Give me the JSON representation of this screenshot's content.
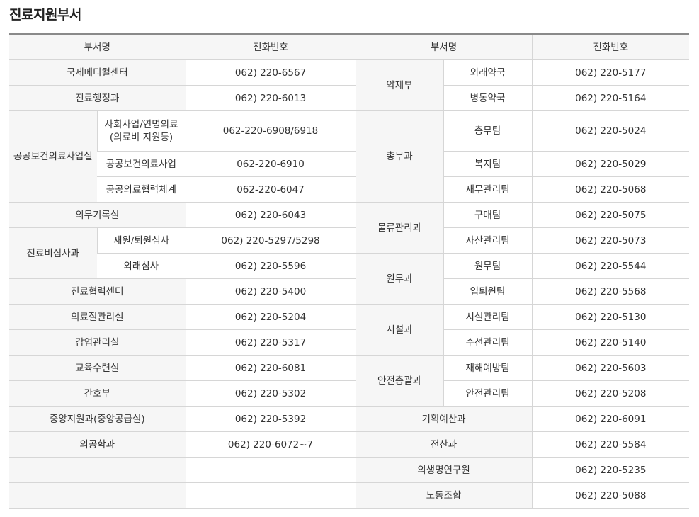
{
  "title": "진료지원부서",
  "headers": {
    "dept": "부서명",
    "phone": "전화번호"
  },
  "left": {
    "r1": {
      "name": "국제메디컬센터",
      "phone": "062) 220-6567"
    },
    "r2": {
      "name": "진료행정과",
      "phone": "062) 220-6013"
    },
    "public": {
      "name": "공공보건의료사업실",
      "subs": [
        {
          "name_line1": "사회사업/연명의료",
          "name_line2": "(의료비 지원등)",
          "phone": "062-220-6908/6918"
        },
        {
          "name": "공공보건의료사업",
          "phone": "062-220-6910"
        },
        {
          "name": "공공의료협력체계",
          "phone": "062-220-6047"
        }
      ]
    },
    "r6": {
      "name": "의무기록실",
      "phone": "062) 220-6043"
    },
    "review": {
      "name": "진료비심사과",
      "subs": [
        {
          "name": "재원/퇴원심사",
          "phone": "062) 220-5297/5298"
        },
        {
          "name": "외래심사",
          "phone": "062) 220-5596"
        }
      ]
    },
    "r9": {
      "name": "진료협력센터",
      "phone": "062) 220-5400"
    },
    "r10": {
      "name": "의료질관리실",
      "phone": "062) 220-5204"
    },
    "r11": {
      "name": "감염관리실",
      "phone": "062) 220-5317"
    },
    "r12": {
      "name": "교육수련실",
      "phone": "062) 220-6081"
    },
    "r13": {
      "name": "간호부",
      "phone": "062) 220-5302"
    },
    "r14": {
      "name": "중앙지원과(중앙공급실)",
      "phone": "062) 220-5392"
    },
    "r15": {
      "name": "의공학과",
      "phone": "062) 220-6072~7"
    }
  },
  "right": {
    "pharmacy": {
      "name": "약제부",
      "subs": [
        {
          "name": "외래약국",
          "phone": "062) 220-5177"
        },
        {
          "name": "병동약국",
          "phone": "062) 220-5164"
        }
      ]
    },
    "general": {
      "name": "총무과",
      "subs": [
        {
          "name": "총무팀",
          "phone": "062) 220-5024"
        },
        {
          "name": "복지팀",
          "phone": "062) 220-5029"
        },
        {
          "name": "재무관리팀",
          "phone": "062) 220-5068"
        }
      ]
    },
    "logistics": {
      "name": "물류관리과",
      "subs": [
        {
          "name": "구매팀",
          "phone": "062) 220-5075"
        },
        {
          "name": "자산관리팀",
          "phone": "062) 220-5073"
        }
      ]
    },
    "admin": {
      "name": "원무과",
      "subs": [
        {
          "name": "원무팀",
          "phone": "062) 220-5544"
        },
        {
          "name": "입퇴원팀",
          "phone": "062) 220-5568"
        }
      ]
    },
    "facility": {
      "name": "시설과",
      "subs": [
        {
          "name": "시설관리팀",
          "phone": "062) 220-5130"
        },
        {
          "name": "수선관리팀",
          "phone": "062) 220-5140"
        }
      ]
    },
    "safety": {
      "name": "안전총괄과",
      "subs": [
        {
          "name": "재해예방팀",
          "phone": "062) 220-5603"
        },
        {
          "name": "안전관리팀",
          "phone": "062) 220-5208"
        }
      ]
    },
    "planning": {
      "name": "기획예산과",
      "phone": "062) 220-6091"
    },
    "computing": {
      "name": "전산과",
      "phone": "062) 220-5584"
    },
    "research": {
      "name": "의생명연구원",
      "phone": "062) 220-5235"
    },
    "union": {
      "name": "노동조합",
      "phone": "062) 220-5088"
    }
  }
}
